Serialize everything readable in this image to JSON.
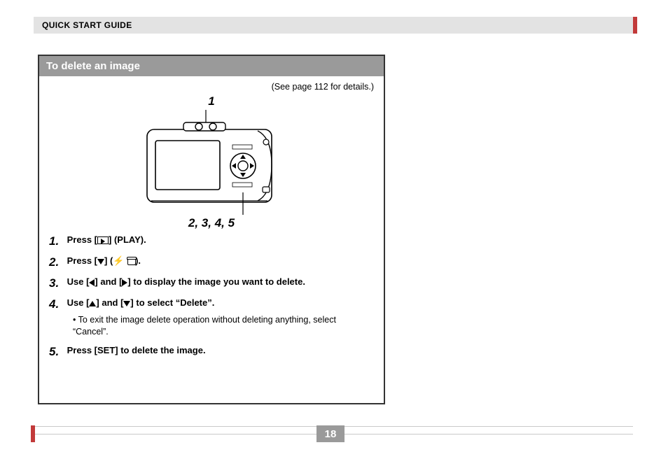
{
  "header": {
    "title": "QUICK START GUIDE"
  },
  "panel": {
    "title": "To delete an image",
    "see_page": "(See page 112 for details.)",
    "callout_top": "1",
    "callout_bottom": "2, 3, 4, 5"
  },
  "steps": [
    {
      "n": "1.",
      "pre": "Press [",
      "icon": "play-rect",
      "post": "] (PLAY)."
    },
    {
      "n": "2.",
      "pre": "Press [",
      "icon": "tri-down",
      "mid": "] (",
      "icon2": "bolt",
      "icon3": "trash",
      "post": ")."
    },
    {
      "n": "3.",
      "pre": "Use [",
      "icon": "tri-left",
      "mid": "] and [",
      "icon2": "tri-right",
      "post": "] to display the image you want to delete."
    },
    {
      "n": "4.",
      "pre": "Use [",
      "icon": "tri-up",
      "mid": "] and [",
      "icon2": "tri-down",
      "post": "] to select “Delete”.",
      "sub": "• To exit the image delete operation without deleting anything, select “Cancel”."
    },
    {
      "n": "5.",
      "text": "Press [SET] to delete the image."
    }
  ],
  "page_number": "18",
  "icons": {
    "bolt": "⚡"
  }
}
